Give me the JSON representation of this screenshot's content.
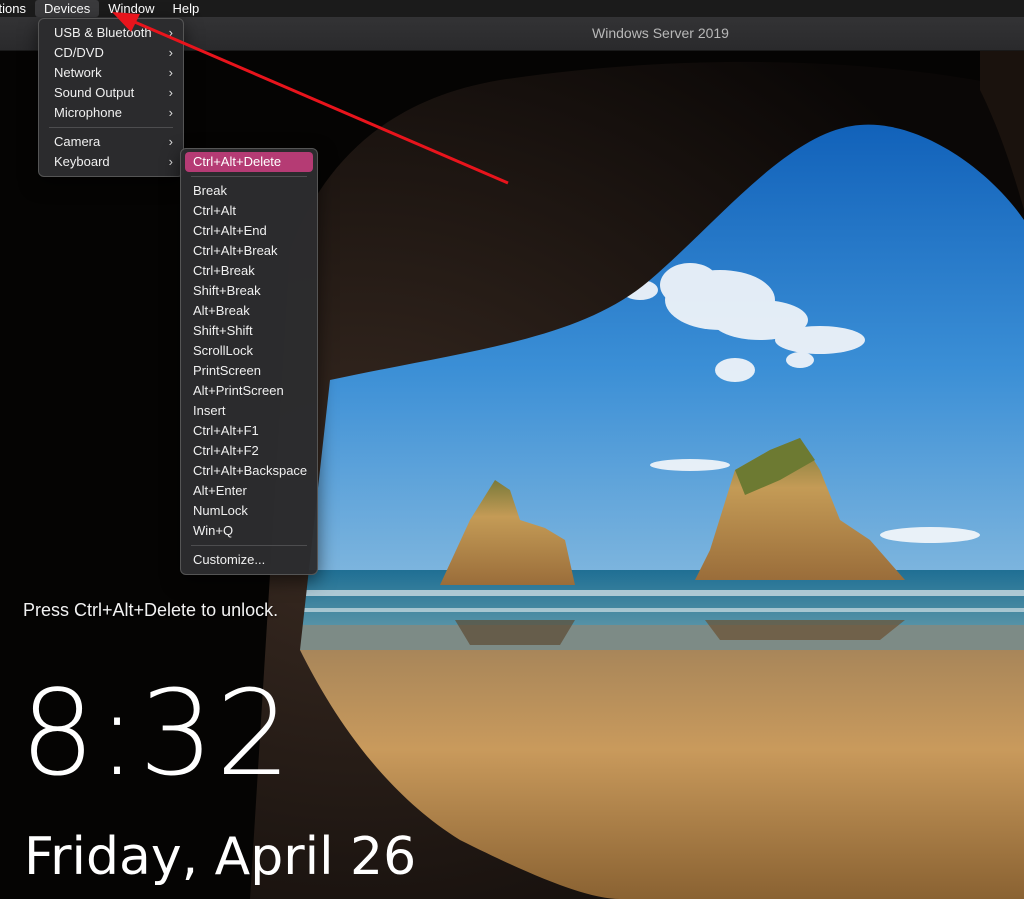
{
  "menubar": {
    "items": [
      "ctions",
      "Devices",
      "Window",
      "Help"
    ]
  },
  "window": {
    "title": "Windows Server 2019"
  },
  "devices_menu": {
    "group1": [
      {
        "label": "USB & Bluetooth",
        "submenu": true
      },
      {
        "label": "CD/DVD",
        "submenu": true
      },
      {
        "label": "Network",
        "submenu": true
      },
      {
        "label": "Sound Output",
        "submenu": true
      },
      {
        "label": "Microphone",
        "submenu": true
      }
    ],
    "group2": [
      {
        "label": "Camera",
        "submenu": true
      },
      {
        "label": "Keyboard",
        "submenu": true
      }
    ]
  },
  "keyboard_menu": {
    "highlighted": "Ctrl+Alt+Delete",
    "items": [
      "Break",
      "Ctrl+Alt",
      "Ctrl+Alt+End",
      "Ctrl+Alt+Break",
      "Ctrl+Break",
      "Shift+Break",
      "Alt+Break",
      "Shift+Shift",
      "ScrollLock",
      "PrintScreen",
      "Alt+PrintScreen",
      "Insert",
      "Ctrl+Alt+F1",
      "Ctrl+Alt+F2",
      "Ctrl+Alt+Backspace",
      "Alt+Enter",
      "NumLock",
      "Win+Q"
    ],
    "customize": "Customize..."
  },
  "lockscreen": {
    "hint": "Press Ctrl+Alt+Delete to unlock.",
    "time": "8:32",
    "date": "Friday, April 26"
  },
  "icons": {
    "submenu_indicator": "chevron-right-icon"
  },
  "colors": {
    "highlight": "#b53b74",
    "annotation_arrow": "#e8141c"
  }
}
